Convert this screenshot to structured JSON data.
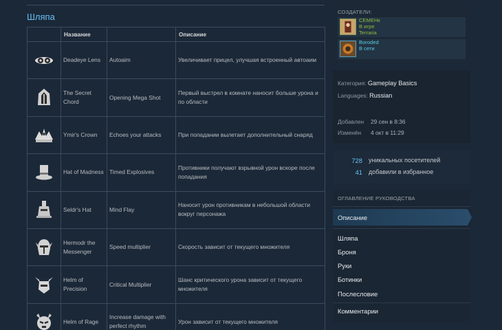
{
  "section_title": "Шляпа",
  "table": {
    "headers": [
      "",
      "Название",
      "",
      "Описание"
    ],
    "rows": [
      {
        "icon": "lens-icon",
        "name": "Deadeye Lens",
        "ability": "Autoaim",
        "desc": "Увеличивает прицел, улучшая встроенный автоаим"
      },
      {
        "icon": "hood-icon",
        "name": "The Secret Chord",
        "ability": "Opening Mega Shot",
        "desc": "Первый выстрел в комнате наносит больше урона и по области"
      },
      {
        "icon": "crown-icon",
        "name": "Ymir's Crown",
        "ability": "Echoes your attacks",
        "desc": "При попадании вылетает дополнительный снаряд"
      },
      {
        "icon": "top-hat-icon",
        "name": "Hat of Madness",
        "ability": "Timed Explosives",
        "desc": "Противники получают взрывной урон вскоре после попадания"
      },
      {
        "icon": "totem-hat-icon",
        "name": "Seldr's Hat",
        "ability": "Mind Flay",
        "desc": "Наносит урон противникам в небольшой области вокруг персонажа"
      },
      {
        "icon": "winged-helm-icon",
        "name": "Hermodr the Messenger",
        "ability": "Speed multiplier",
        "desc": "Скорость зависит от текущего множителя"
      },
      {
        "icon": "horned-helm-icon",
        "name": "Helm of Precision",
        "ability": "Critical Multiplier",
        "desc": "Шанс критического урона зависит от текущего множителя"
      },
      {
        "icon": "rage-helm-icon",
        "name": "Helm of Rage",
        "ability": "Increase damage with perfect rhythm",
        "desc": "Урон зависит от текущего множителя"
      }
    ]
  },
  "sidebar": {
    "creators_title": "СОЗДАТЕЛИ:",
    "creators": [
      {
        "name": "СЕМЕНк",
        "status": "В игре",
        "game": "Terraria",
        "avatar": "avatar-icon"
      },
      {
        "name": "Boroded",
        "status": "В сети",
        "game": "",
        "avatar": "avatar-icon"
      }
    ],
    "category_label": "Категория:",
    "category_value": "Gameplay Basics",
    "languages_label": "Languages:",
    "languages_value": "Russian",
    "added_label": "Добавлен",
    "added_value": "29 сен в 8:36",
    "changed_label": "Изменён",
    "changed_value": "4 окт в 11:29",
    "visitors_count": "728",
    "visitors_label": "уникальных посетителей",
    "favorites_count": "41",
    "favorites_label": "добавили в избранное",
    "toc_title": "ОГЛАВЛЕНИЕ РУКОВОДСТВА",
    "toc": [
      "Описание",
      "Шляпа",
      "Броня",
      "Руки",
      "Ботинки",
      "Послесловие",
      "Комментарии"
    ]
  },
  "colors": {
    "background": "#1b2838",
    "accent": "#66c0f4",
    "ingame": "#90ba3c",
    "online": "#57cbde"
  }
}
